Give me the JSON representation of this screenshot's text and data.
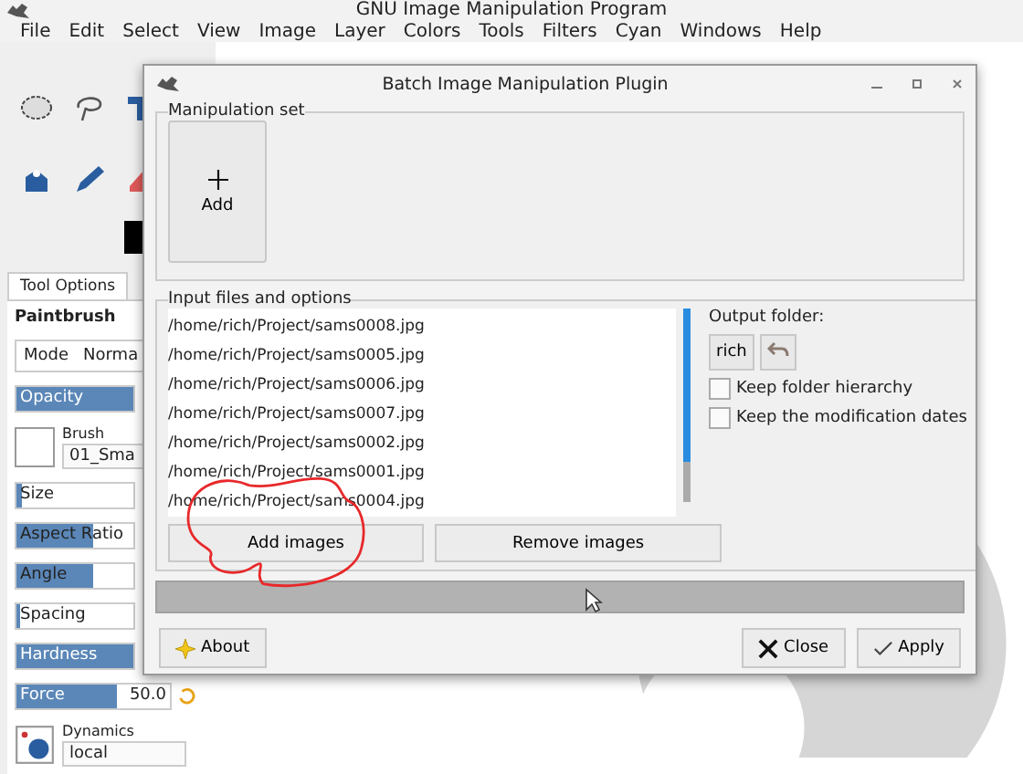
{
  "window": {
    "title": "GNU Image Manipulation Program"
  },
  "menu": [
    "File",
    "Edit",
    "Select",
    "View",
    "Image",
    "Layer",
    "Colors",
    "Tools",
    "Filters",
    "Cyan",
    "Windows",
    "Help"
  ],
  "tool_options": {
    "tab": "Tool Options",
    "tool": "Paintbrush",
    "mode_label": "Mode",
    "mode_value": "Norma",
    "brush_label": "Brush",
    "brush_value": "01_Sma",
    "dynamics_label": "Dynamics",
    "dynamics_value": "local",
    "sliders": [
      {
        "kind": "slider",
        "label": "Opacity",
        "level": 1.0
      },
      {
        "kind": "brush"
      },
      {
        "kind": "slider",
        "label": "Size",
        "level": 0.05
      },
      {
        "kind": "slider",
        "label": "Aspect Ratio",
        "level": 0.65
      },
      {
        "kind": "slider",
        "label": "Angle",
        "level": 0.65
      },
      {
        "kind": "slider",
        "label": "Spacing",
        "level": 0.03
      },
      {
        "kind": "slider",
        "label": "Hardness",
        "level": 1.0
      },
      {
        "kind": "spin",
        "label": "Force",
        "value": "50.0",
        "level": 0.65
      }
    ]
  },
  "dialog": {
    "title": "Batch Image Manipulation Plugin",
    "manipulation_set": {
      "title": "Manipulation set",
      "add_button": "Add"
    },
    "input": {
      "title": "Input files and options",
      "files": [
        "/home/rich/Project/sams0008.jpg",
        "/home/rich/Project/sams0005.jpg",
        "/home/rich/Project/sams0006.jpg",
        "/home/rich/Project/sams0007.jpg",
        "/home/rich/Project/sams0002.jpg",
        "/home/rich/Project/sams0001.jpg",
        "/home/rich/Project/sams0004.jpg"
      ],
      "output_label": "Output folder:",
      "folder_button": "rich",
      "options": [
        {
          "label": "Keep folder hierarchy",
          "checked": false
        },
        {
          "label": "Keep the modification dates",
          "checked": false
        }
      ],
      "add_images": "Add images",
      "remove_images": "Remove images"
    },
    "progress": {
      "level": 0
    },
    "about": "About",
    "close": "Close",
    "apply": "Apply"
  }
}
